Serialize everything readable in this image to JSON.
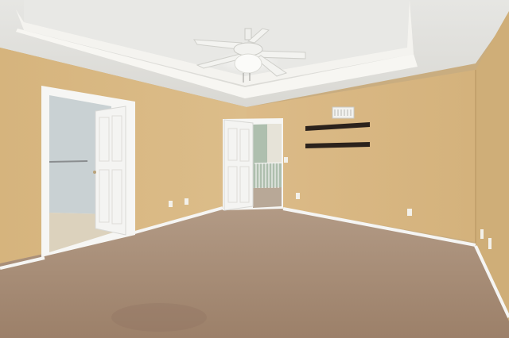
{
  "scene": {
    "subject": "empty-bedroom-interior",
    "colors": {
      "wall": "#d9b883",
      "wall_shadow": "#c9a670",
      "right_wall": "#cfae78",
      "ceiling": "#e4e4e1",
      "tray_trim": "#f3f2ee",
      "carpet": "#a98e78",
      "door": "#f4f4f2",
      "baseboard": "#f5f5f3",
      "shelf": "#2b221c",
      "bathroom_wall": "#c9d1d3",
      "bathroom_floor": "#dcd2bd",
      "hallway_wall": "#aebfae"
    }
  }
}
